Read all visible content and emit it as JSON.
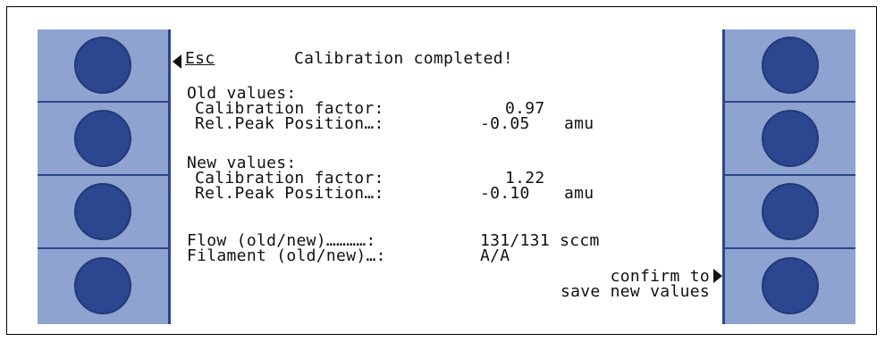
{
  "header": {
    "esc_label": "Esc",
    "title": "Calibration completed!"
  },
  "old": {
    "heading": "Old values:",
    "cal_label": "Calibration factor:",
    "cal_value": "0.97",
    "peak_label": "Rel.Peak Position…:",
    "peak_value": "-0.05",
    "peak_unit": "amu"
  },
  "new": {
    "heading": "New values:",
    "cal_label": "Calibration factor:",
    "cal_value": "1.22",
    "peak_label": "Rel.Peak Position…:",
    "peak_value": "-0.10",
    "peak_unit": "amu"
  },
  "flow": {
    "label": "Flow (old/new)…………:",
    "value": "131/131 sccm"
  },
  "filament": {
    "label": "Filament (old/new)…:",
    "value": "A/A"
  },
  "confirm": {
    "line1": "confirm to",
    "line2": "save new values"
  },
  "colors": {
    "panel": "#8fa3d0",
    "knob": "#2c468f",
    "display_bg": "#ffffff",
    "text": "#111111"
  },
  "icons": {
    "esc": "left-arrow-icon",
    "confirm": "right-arrow-icon"
  }
}
